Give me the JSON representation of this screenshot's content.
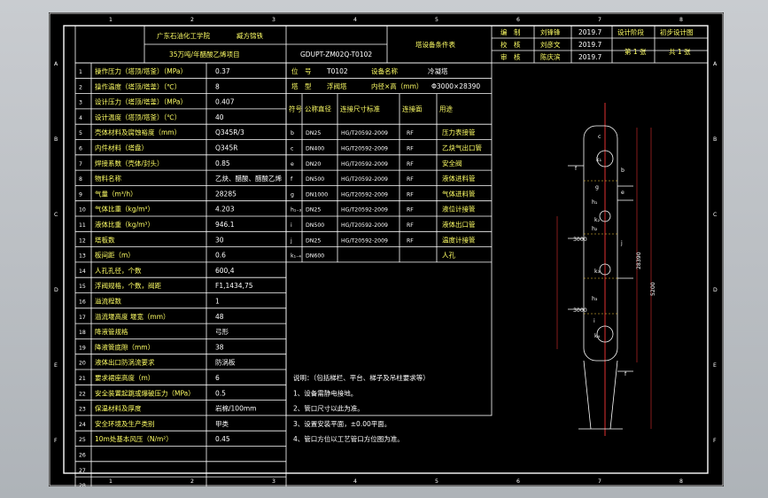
{
  "title_block": {
    "school": "广东石油化工学院",
    "designer_role": "臧方锦铁",
    "project": "35万吨/年醋酸乙烯项目",
    "drawing_no": "GDUPT-ZM02Q-T0102",
    "sheet_title": "塔设备条件表",
    "rows": [
      {
        "label": "编　制",
        "name": "刘锋锋",
        "date": "2019.7",
        "stage_label": "设计阶段",
        "stage": "初步设计图"
      },
      {
        "label": "校　核",
        "name": "刘彦文",
        "date": "2019.7"
      },
      {
        "label": "审　核",
        "name": "陈庆滨",
        "date": "2019.7",
        "page": "第 1 张",
        "total": "共 1 张"
      }
    ]
  },
  "border_letters_left": [
    "A",
    "B",
    "C",
    "D",
    "E",
    "F"
  ],
  "border_numbers_top": [
    "1",
    "2",
    "3",
    "4",
    "5",
    "6",
    "7",
    "8"
  ],
  "params": [
    {
      "no": "1",
      "name": "操作压力（塔顶/塔釜）（MPa）",
      "value": "0.37"
    },
    {
      "no": "2",
      "name": "操作温度（塔顶/塔釜）（℃）",
      "value": "8"
    },
    {
      "no": "3",
      "name": "设计压力（塔顶/塔釜）（MPa）",
      "value": "0.407"
    },
    {
      "no": "4",
      "name": "设计温度（塔顶/塔釜）（℃）",
      "value": "40"
    },
    {
      "no": "5",
      "name": "壳体材料及腐蚀裕度（mm）",
      "value": "Q345R/3"
    },
    {
      "no": "6",
      "name": "内件材料（塔盘）",
      "value": "Q345R"
    },
    {
      "no": "7",
      "name": "焊接系数（壳体/封头）",
      "value": "0.85"
    },
    {
      "no": "8",
      "name": "物料名称",
      "value": "乙炔、醋酸、醋酸乙烯"
    },
    {
      "no": "9",
      "name": "气量（m³/h）",
      "value": "28285"
    },
    {
      "no": "10",
      "name": "气体比重（kg/m³）",
      "value": "4.203"
    },
    {
      "no": "11",
      "name": "液体比重（kg/m³）",
      "value": "946.1"
    },
    {
      "no": "12",
      "name": "塔板数",
      "value": "30"
    },
    {
      "no": "13",
      "name": "板间距（m）",
      "value": "0.6"
    },
    {
      "no": "14",
      "name": "人孔孔径，个数",
      "value": "600,4"
    },
    {
      "no": "15",
      "name": "浮阀规格，个数，阀距",
      "value": "F1,1434,75"
    },
    {
      "no": "16",
      "name": "溢流程数",
      "value": "1"
    },
    {
      "no": "17",
      "name": "溢流堰高度  堰宽（mm）",
      "value": "48"
    },
    {
      "no": "18",
      "name": "降液管规格",
      "value": "弓形"
    },
    {
      "no": "19",
      "name": "降液管底隙（mm）",
      "value": "38"
    },
    {
      "no": "20",
      "name": "液体出口防涡流要求",
      "value": "防涡板"
    },
    {
      "no": "21",
      "name": "要求裙座高度（m）",
      "value": "6"
    },
    {
      "no": "22",
      "name": "安全装置起跳或爆破压力（MPa）",
      "value": "0.5"
    },
    {
      "no": "23",
      "name": "保温材料及厚度",
      "value": "岩棉/100mm"
    },
    {
      "no": "24",
      "name": "安全环境及生产类别",
      "value": "甲类"
    },
    {
      "no": "25",
      "name": "10m处基本风压（N/m²）",
      "value": "0.45"
    },
    {
      "no": "26",
      "name": "",
      "value": ""
    },
    {
      "no": "27",
      "name": "",
      "value": ""
    },
    {
      "no": "28",
      "name": "",
      "value": ""
    }
  ],
  "equipment": {
    "pos_label": "位　号",
    "pos_value": "T0102",
    "name_label": "设备名称",
    "name_value": "冷凝塔",
    "type_label": "塔　型",
    "type_value": "浮阀塔",
    "dim_label": "内径×高（mm）",
    "dim_value": "Φ3000×28390"
  },
  "nozzle_header": [
    "符号",
    "公称直径",
    "连接尺寸标准",
    "连接面",
    "用途"
  ],
  "nozzles": [
    {
      "sym": "b",
      "dn": "DN25",
      "std": "HG/T20592-2009",
      "face": "RF",
      "use": "压力表接管"
    },
    {
      "sym": "c",
      "dn": "DN400",
      "std": "HG/T20592-2009",
      "face": "RF",
      "use": "乙炔气出口管"
    },
    {
      "sym": "e",
      "dn": "DN20",
      "std": "HG/T20592-2009",
      "face": "RF",
      "use": "安全阀"
    },
    {
      "sym": "f",
      "dn": "DN500",
      "std": "HG/T20592-2009",
      "face": "RF",
      "use": "液体进料管"
    },
    {
      "sym": "g",
      "dn": "DN1000",
      "std": "HG/T20592-2009",
      "face": "RF",
      "use": "气体进料管"
    },
    {
      "sym": "h₁₋₃",
      "dn": "DN25",
      "std": "HG/T20592-2009",
      "face": "RF",
      "use": "液位计接管"
    },
    {
      "sym": "i",
      "dn": "DN500",
      "std": "HG/T20592-2009",
      "face": "RF",
      "use": "液体出口管"
    },
    {
      "sym": "j",
      "dn": "DN25",
      "std": "HG/T20592-2009",
      "face": "RF",
      "use": "温度计接管"
    },
    {
      "sym": "k₁₋₄",
      "dn": "DN600",
      "std": "",
      "face": "",
      "use": "人孔"
    }
  ],
  "notes": [
    "说明：（包括梯栏、平台、梯子及吊柱要求等）",
    "1、设备需静电接地。",
    "2、管口尺寸以此为准。",
    "3、设置安装平面，±0.00平面。",
    "4、管口方位以工艺管口方位图为准。"
  ],
  "drawing_labels": [
    "f",
    "g",
    "h₁",
    "h₂",
    "h₃",
    "i",
    "k₁",
    "k₂",
    "k₃",
    "k₄",
    "c",
    "b",
    "e",
    "j",
    "f"
  ],
  "drawing_dims": [
    "28390",
    "5200",
    "3000",
    "3000"
  ]
}
